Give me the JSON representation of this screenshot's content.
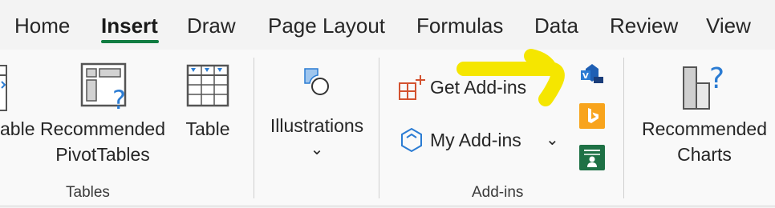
{
  "tabs": [
    {
      "label": "Home",
      "active": false
    },
    {
      "label": "Insert",
      "active": true
    },
    {
      "label": "Draw",
      "active": false
    },
    {
      "label": "Page Layout",
      "active": false
    },
    {
      "label": "Formulas",
      "active": false
    },
    {
      "label": "Data",
      "active": false
    },
    {
      "label": "Review",
      "active": false
    },
    {
      "label": "View",
      "active": false
    }
  ],
  "groups": {
    "tables": {
      "label": "Tables",
      "partial_label": "able",
      "recommended_pivot_line1": "Recommended",
      "recommended_pivot_line2": "PivotTables",
      "table_label": "Table"
    },
    "illustrations": {
      "label": "Illustrations",
      "chevron": "⌄"
    },
    "addins": {
      "label": "Add-ins",
      "get_addins": "Get Add-ins",
      "my_addins": "My Add-ins",
      "my_addins_chevron": "⌄",
      "icons": [
        "visio-data-visualizer-icon",
        "bing-maps-icon",
        "people-graph-icon"
      ]
    },
    "charts": {
      "recommended_charts_line1": "Recommended",
      "recommended_charts_line2": "Charts"
    }
  },
  "annotation": {
    "arrow_color": "#f5e600"
  },
  "colors": {
    "active_tab_underline": "#107c41",
    "accent_blue": "#2b7cd3",
    "bing_orange": "#f8a41c",
    "excel_green": "#1e7145",
    "addins_orange": "#d35230"
  }
}
